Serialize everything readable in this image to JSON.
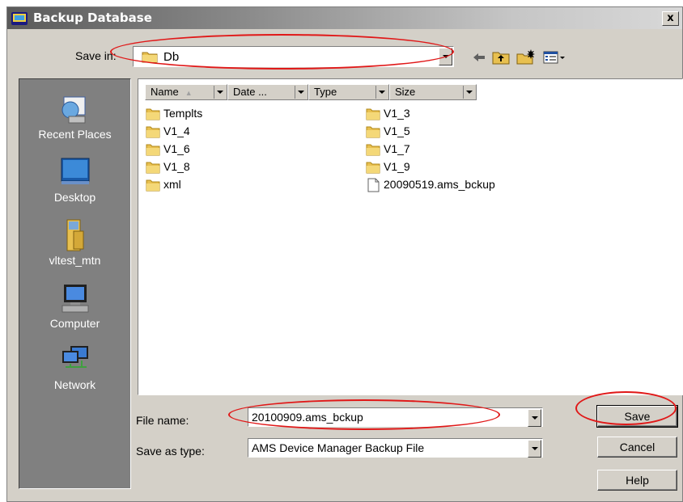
{
  "window": {
    "title": "Backup Database",
    "close_label": "x"
  },
  "save_in": {
    "label": "Save in:",
    "value": "Db"
  },
  "toolbar": {
    "icons": [
      "back-arrow-icon",
      "up-folder-icon",
      "new-folder-icon",
      "view-menu-icon"
    ]
  },
  "places": [
    {
      "label": "Recent Places",
      "icon": "recent-places-icon"
    },
    {
      "label": "Desktop",
      "icon": "desktop-icon"
    },
    {
      "label": "vltest_mtn",
      "icon": "user-folder-icon"
    },
    {
      "label": "Computer",
      "icon": "computer-icon"
    },
    {
      "label": "Network",
      "icon": "network-icon"
    }
  ],
  "columns": [
    "Name",
    "Date ...",
    "Type",
    "Size"
  ],
  "files": [
    {
      "name": "Templts",
      "kind": "folder"
    },
    {
      "name": "V1_3",
      "kind": "folder"
    },
    {
      "name": "V1_4",
      "kind": "folder"
    },
    {
      "name": "V1_5",
      "kind": "folder"
    },
    {
      "name": "V1_6",
      "kind": "folder"
    },
    {
      "name": "V1_7",
      "kind": "folder"
    },
    {
      "name": "V1_8",
      "kind": "folder"
    },
    {
      "name": "V1_9",
      "kind": "folder"
    },
    {
      "name": "xml",
      "kind": "folder"
    },
    {
      "name": "20090519.ams_bckup",
      "kind": "file"
    }
  ],
  "file_name": {
    "label": "File name:",
    "value": "20100909.ams_bckup"
  },
  "save_as_type": {
    "label": "Save as type:",
    "value": "AMS Device Manager Backup File"
  },
  "buttons": {
    "save": "Save",
    "cancel": "Cancel",
    "help": "Help"
  },
  "colors": {
    "annotation": "#e01818",
    "dialog": "#d4d0c8",
    "places_bg": "#808080"
  }
}
